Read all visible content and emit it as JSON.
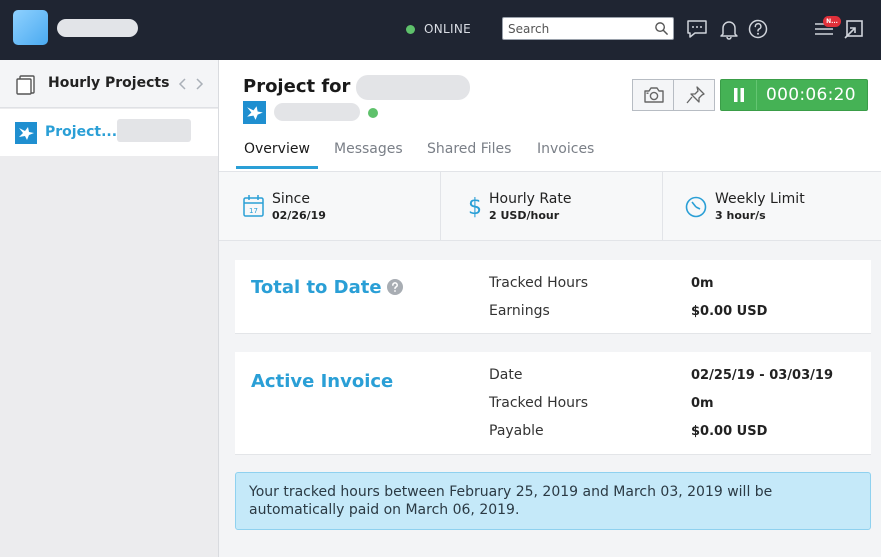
{
  "topbar": {
    "status_text": "ONLINE",
    "search_placeholder": "Search",
    "notif_badge": "N..."
  },
  "sidebar": {
    "title": "Hourly Projects",
    "items": [
      {
        "label": "Project..."
      }
    ]
  },
  "project": {
    "title_prefix": "Project for",
    "timer": "000:06:20"
  },
  "tabs": [
    {
      "label": "Overview"
    },
    {
      "label": "Messages"
    },
    {
      "label": "Shared Files"
    },
    {
      "label": "Invoices"
    }
  ],
  "info": [
    {
      "label": "Since",
      "value": "02/26/19",
      "icon": "calendar-icon",
      "calendar_day": "17"
    },
    {
      "label": "Hourly Rate",
      "value": "2 USD/hour",
      "icon": "dollar-icon"
    },
    {
      "label": "Weekly Limit",
      "value": "3 hour/s",
      "icon": "clock-icon"
    }
  ],
  "total_to_date": {
    "heading": "Total to Date",
    "rows": [
      {
        "label": "Tracked Hours",
        "value": "0m"
      },
      {
        "label": "Earnings",
        "value": "$0.00 USD"
      }
    ]
  },
  "active_invoice": {
    "heading": "Active Invoice",
    "rows": [
      {
        "label": "Date",
        "value": "02/25/19 - 03/03/19"
      },
      {
        "label": "Tracked Hours",
        "value": "0m"
      },
      {
        "label": "Payable",
        "value": "$0.00 USD"
      }
    ]
  },
  "notice": "Your tracked hours between February 25, 2019 and March 03, 2019 will be automatically paid on March 06, 2019.",
  "colors": {
    "topbar_bg": "#1f2532",
    "accent_blue": "#2a9fd6",
    "timer_green": "#45b255",
    "online_green": "#5ec16b",
    "notice_bg": "#c5e9f9"
  }
}
